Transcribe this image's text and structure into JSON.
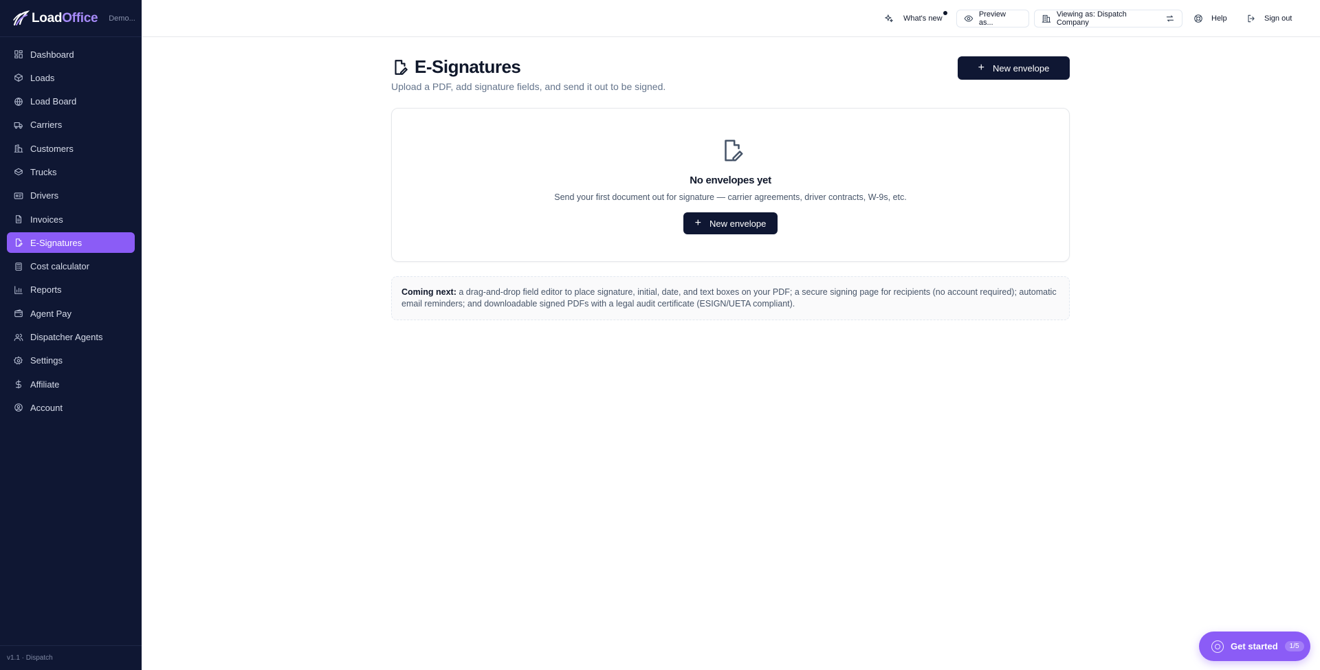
{
  "brand": {
    "name_part1": "Load",
    "name_part2": "Office",
    "org": "Demo..."
  },
  "sidebar": {
    "items": [
      {
        "label": "Dashboard",
        "icon": "dashboard-icon"
      },
      {
        "label": "Loads",
        "icon": "package-icon"
      },
      {
        "label": "Load Board",
        "icon": "globe-icon"
      },
      {
        "label": "Carriers",
        "icon": "truck-icon"
      },
      {
        "label": "Customers",
        "icon": "building-icon"
      },
      {
        "label": "Trucks",
        "icon": "box-icon"
      },
      {
        "label": "Drivers",
        "icon": "id-card-icon"
      },
      {
        "label": "Invoices",
        "icon": "file-icon"
      },
      {
        "label": "E-Signatures",
        "icon": "file-signature-icon",
        "active": true
      },
      {
        "label": "Cost calculator",
        "icon": "calculator-icon"
      },
      {
        "label": "Reports",
        "icon": "bar-chart-icon"
      },
      {
        "label": "Agent Pay",
        "icon": "wallet-icon"
      },
      {
        "label": "Dispatcher Agents",
        "icon": "users-icon"
      },
      {
        "label": "Settings",
        "icon": "gear-icon"
      },
      {
        "label": "Affiliate",
        "icon": "dollar-icon"
      },
      {
        "label": "Account",
        "icon": "user-circle-icon"
      }
    ],
    "footer": "v1.1 · Dispatch"
  },
  "topbar": {
    "whats_new": "What's new",
    "preview": "Preview as...",
    "viewing": "Viewing as: Dispatch Company",
    "help": "Help",
    "signout": "Sign out"
  },
  "page": {
    "title": "E-Signatures",
    "subtitle": "Upload a PDF, add signature fields, and send it out to be signed.",
    "new_envelope": "New envelope"
  },
  "empty": {
    "title": "No envelopes yet",
    "description": "Send your first document out for signature — carrier agreements, driver contracts, W-9s, etc.",
    "button": "New envelope"
  },
  "note": {
    "bold": "Coming next:",
    "text": "a drag-and-drop field editor to place signature, initial, date, and text boxes on your PDF; a secure signing page for recipients (no account required); automatic email reminders; and downloadable signed PDFs with a legal audit certificate (ESIGN/UETA compliant)."
  },
  "get_started": {
    "label": "Get started",
    "progress": "1/5"
  },
  "colors": {
    "sidebar_bg": "#0f1733",
    "accent": "#8b5cf6",
    "primary_button": "#0f1733"
  }
}
